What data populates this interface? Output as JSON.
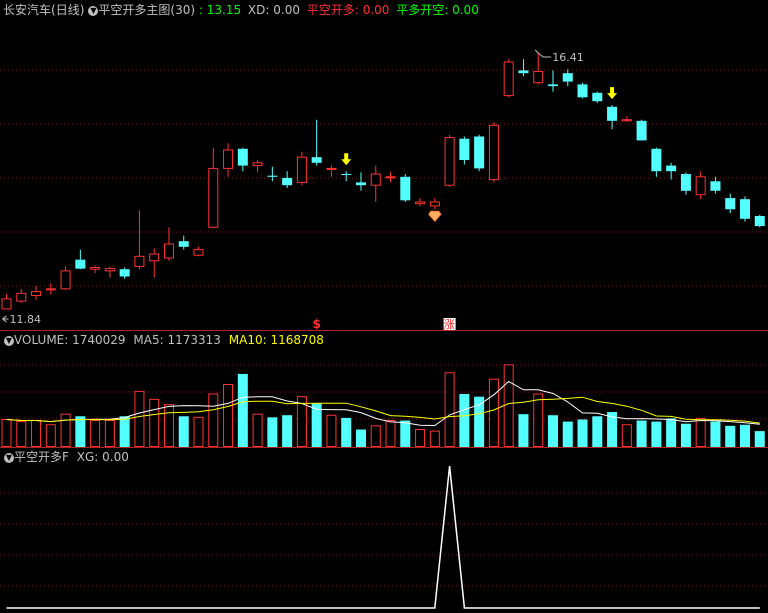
{
  "header": {
    "symbol": "长安汽车",
    "period": "(日线)",
    "indicator": "平空开多主图",
    "indicator_param": "(30)",
    "last_value": ": 13.15",
    "xd_label": "XD:",
    "xd_value": "0.00",
    "pkkd_label": "平空开多:",
    "pkkd_value": "0.00",
    "pdkk_label": "平多开空:",
    "pdkk_value": "0.00"
  },
  "volume_header": {
    "label": "VOLUME:",
    "value": "1740029",
    "ma5_label": "MA5:",
    "ma5_value": "1173313",
    "ma10_label": "MA10:",
    "ma10_value": "1168708"
  },
  "sub_header": {
    "label": "平空开多F",
    "xg_label": "XG:",
    "xg_value": "0.00"
  },
  "price_labels": {
    "high": "16.41",
    "low": "11.84"
  },
  "markers": {
    "dollar": "$",
    "zhang": "涨"
  },
  "colors": {
    "up": "#ff3232",
    "down": "#54ffff",
    "ma5": "#ffffff",
    "ma10": "#ffff00",
    "arrow": "#ffff00",
    "xd": "#00ff00",
    "grid": "#7a1a1a"
  },
  "chart_data": [
    {
      "type": "candlestick",
      "ylim": [
        11.5,
        17.0
      ],
      "candles": [
        {
          "o": 11.84,
          "h": 12.1,
          "l": 11.84,
          "c": 12.02,
          "up": true
        },
        {
          "o": 11.98,
          "h": 12.2,
          "l": 11.95,
          "c": 12.12,
          "up": true
        },
        {
          "o": 12.08,
          "h": 12.25,
          "l": 12.0,
          "c": 12.15,
          "up": true
        },
        {
          "o": 12.18,
          "h": 12.3,
          "l": 12.1,
          "c": 12.2,
          "up": true
        },
        {
          "o": 12.2,
          "h": 12.6,
          "l": 12.18,
          "c": 12.52,
          "up": true
        },
        {
          "o": 12.72,
          "h": 12.9,
          "l": 12.55,
          "c": 12.56,
          "up": false
        },
        {
          "o": 12.55,
          "h": 12.62,
          "l": 12.48,
          "c": 12.58,
          "up": true
        },
        {
          "o": 12.52,
          "h": 12.6,
          "l": 12.4,
          "c": 12.56,
          "up": true
        },
        {
          "o": 12.55,
          "h": 12.58,
          "l": 12.38,
          "c": 12.42,
          "up": false
        },
        {
          "o": 12.6,
          "h": 13.6,
          "l": 12.55,
          "c": 12.78,
          "up": true
        },
        {
          "o": 12.7,
          "h": 12.92,
          "l": 12.4,
          "c": 12.82,
          "up": true
        },
        {
          "o": 12.75,
          "h": 13.3,
          "l": 12.7,
          "c": 13.0,
          "up": true
        },
        {
          "o": 13.05,
          "h": 13.15,
          "l": 12.9,
          "c": 12.95,
          "up": false
        },
        {
          "o": 12.8,
          "h": 12.95,
          "l": 12.78,
          "c": 12.9,
          "up": true
        },
        {
          "o": 13.3,
          "h": 14.72,
          "l": 13.28,
          "c": 14.35,
          "up": true
        },
        {
          "o": 14.35,
          "h": 14.8,
          "l": 14.2,
          "c": 14.68,
          "up": true
        },
        {
          "o": 14.7,
          "h": 14.72,
          "l": 14.3,
          "c": 14.4,
          "up": false
        },
        {
          "o": 14.4,
          "h": 14.5,
          "l": 14.28,
          "c": 14.45,
          "up": true
        },
        {
          "o": 14.22,
          "h": 14.38,
          "l": 14.12,
          "c": 14.2,
          "up": false
        },
        {
          "o": 14.18,
          "h": 14.3,
          "l": 14.0,
          "c": 14.05,
          "up": false
        },
        {
          "o": 14.1,
          "h": 14.65,
          "l": 14.05,
          "c": 14.55,
          "up": true
        },
        {
          "o": 14.55,
          "h": 15.22,
          "l": 14.4,
          "c": 14.45,
          "up": false
        },
        {
          "o": 14.35,
          "h": 14.4,
          "l": 14.2,
          "c": 14.35,
          "up": true
        },
        {
          "o": 14.25,
          "h": 14.3,
          "l": 14.12,
          "c": 14.25,
          "up": false
        },
        {
          "o": 14.1,
          "h": 14.28,
          "l": 13.95,
          "c": 14.05,
          "up": false
        },
        {
          "o": 14.05,
          "h": 14.4,
          "l": 13.75,
          "c": 14.25,
          "up": true
        },
        {
          "o": 14.2,
          "h": 14.28,
          "l": 14.1,
          "c": 14.2,
          "up": true
        },
        {
          "o": 14.2,
          "h": 14.25,
          "l": 13.75,
          "c": 13.78,
          "up": false
        },
        {
          "o": 13.72,
          "h": 13.82,
          "l": 13.68,
          "c": 13.75,
          "up": true
        },
        {
          "o": 13.68,
          "h": 13.82,
          "l": 13.62,
          "c": 13.75,
          "up": true
        },
        {
          "o": 14.05,
          "h": 14.95,
          "l": 14.02,
          "c": 14.9,
          "up": true
        },
        {
          "o": 14.88,
          "h": 14.92,
          "l": 14.42,
          "c": 14.5,
          "up": false
        },
        {
          "o": 14.92,
          "h": 14.95,
          "l": 14.3,
          "c": 14.35,
          "up": false
        },
        {
          "o": 14.15,
          "h": 15.18,
          "l": 14.1,
          "c": 15.12,
          "up": true
        },
        {
          "o": 15.65,
          "h": 16.3,
          "l": 15.62,
          "c": 16.25,
          "up": true
        },
        {
          "o": 16.1,
          "h": 16.3,
          "l": 16.0,
          "c": 16.05,
          "up": false
        },
        {
          "o": 15.88,
          "h": 16.41,
          "l": 15.85,
          "c": 16.08,
          "up": true
        },
        {
          "o": 15.82,
          "h": 16.1,
          "l": 15.72,
          "c": 15.85,
          "up": false
        },
        {
          "o": 16.05,
          "h": 16.12,
          "l": 15.82,
          "c": 15.9,
          "up": false
        },
        {
          "o": 15.85,
          "h": 15.88,
          "l": 15.6,
          "c": 15.62,
          "up": false
        },
        {
          "o": 15.7,
          "h": 15.72,
          "l": 15.52,
          "c": 15.55,
          "up": false
        },
        {
          "o": 15.45,
          "h": 15.48,
          "l": 15.05,
          "c": 15.2,
          "up": false
        },
        {
          "o": 15.22,
          "h": 15.28,
          "l": 15.18,
          "c": 15.2,
          "up": true
        },
        {
          "o": 15.2,
          "h": 15.22,
          "l": 14.85,
          "c": 14.85,
          "up": false
        },
        {
          "o": 14.7,
          "h": 14.72,
          "l": 14.2,
          "c": 14.3,
          "up": false
        },
        {
          "o": 14.4,
          "h": 14.45,
          "l": 14.15,
          "c": 14.3,
          "up": false
        },
        {
          "o": 14.25,
          "h": 14.28,
          "l": 13.88,
          "c": 13.95,
          "up": false
        },
        {
          "o": 13.88,
          "h": 14.3,
          "l": 13.8,
          "c": 14.2,
          "up": true
        },
        {
          "o": 14.12,
          "h": 14.2,
          "l": 13.9,
          "c": 13.95,
          "up": false
        },
        {
          "o": 13.82,
          "h": 13.9,
          "l": 13.55,
          "c": 13.62,
          "up": false
        },
        {
          "o": 13.8,
          "h": 13.85,
          "l": 13.4,
          "c": 13.45,
          "up": false
        },
        {
          "o": 13.5,
          "h": 13.52,
          "l": 13.3,
          "c": 13.32,
          "up": false
        }
      ],
      "arrows": [
        23,
        41
      ],
      "diamond": 29,
      "dollar_at": 21,
      "zhang_at": 30
    },
    {
      "type": "bar",
      "title": "VOLUME",
      "ylim": [
        0,
        1850000
      ],
      "volumes": [
        520000,
        480000,
        500000,
        420000,
        620000,
        580000,
        500000,
        500000,
        580000,
        1050000,
        900000,
        800000,
        580000,
        560000,
        1000000,
        1180000,
        1380000,
        620000,
        560000,
        600000,
        950000,
        820000,
        600000,
        550000,
        330000,
        400000,
        500000,
        500000,
        330000,
        300000,
        1400000,
        1000000,
        950000,
        1280000,
        1550000,
        620000,
        1000000,
        600000,
        480000,
        520000,
        580000,
        660000,
        420000,
        500000,
        480000,
        540000,
        440000,
        540000,
        480000,
        400000,
        420000,
        300000
      ]
    },
    {
      "type": "line",
      "title": "平空开多F",
      "ylim": [
        0,
        1
      ],
      "xg": [
        0,
        0,
        0,
        0,
        0,
        0,
        0,
        0,
        0,
        0,
        0,
        0,
        0,
        0,
        0,
        0,
        0,
        0,
        0,
        0,
        0,
        0,
        0,
        0,
        0,
        0,
        0,
        0,
        0,
        0,
        1,
        0,
        0,
        0,
        0,
        0,
        0,
        0,
        0,
        0,
        0,
        0,
        0,
        0,
        0,
        0,
        0,
        0,
        0,
        0,
        0,
        0
      ]
    }
  ]
}
